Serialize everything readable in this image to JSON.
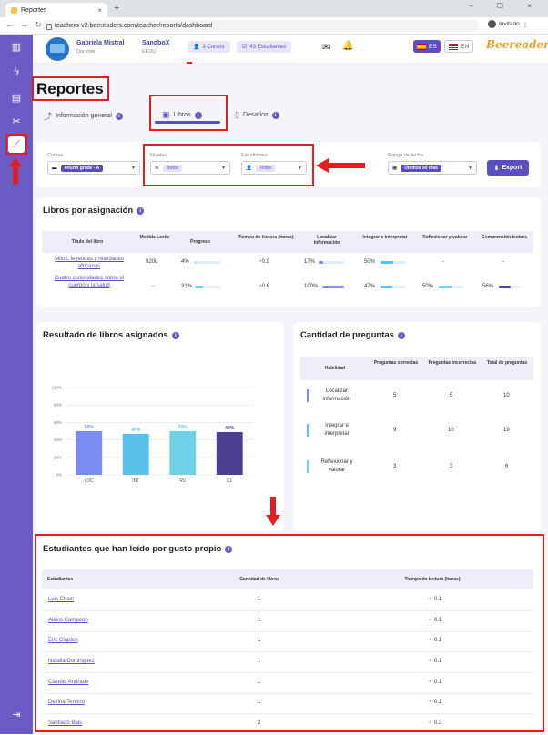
{
  "browser": {
    "tab_title": "Reportes",
    "url": "teachers-v2.beereaders.com/teacher/reports/dashboard",
    "profile": "Invitado"
  },
  "header": {
    "user_name": "Gabriela Mistral",
    "user_role": "Docente",
    "school_name": "SandboX",
    "school_sub": "EEUU",
    "courses_pill": "3 Cursos",
    "students_pill": "43 Estudiantes",
    "lang_es": "ES",
    "lang_en": "EN",
    "logo_text": "Beereaders"
  },
  "page": {
    "title": "Reportes",
    "tabs": [
      {
        "label": "Información general",
        "icon": "trend-icon"
      },
      {
        "label": "Libros",
        "icon": "book-icon",
        "active": true
      },
      {
        "label": "Desafíos",
        "icon": "document-icon"
      }
    ]
  },
  "filters": {
    "courses_label": "Cursos",
    "courses_value": "Fourth grade - A",
    "levels_label": "Niveles",
    "levels_value": "Todos",
    "students_label": "Estudiantes",
    "students_value": "Todos",
    "date_label": "Rango de fecha",
    "date_value": "Últimos 90 días",
    "export_label": "Export"
  },
  "assignment": {
    "title": "Libros por asignación",
    "headers": [
      "Título del libro",
      "Medida Lexile",
      "Progreso",
      "Tiempo de lectura (horas)",
      "Localizar información",
      "Integrar e interpretar",
      "Reflexionar y valorar",
      "Comprensión lectora"
    ],
    "rows": [
      {
        "title": "Mitos, leyendas y realidades africanas",
        "lexile": "920L",
        "progress": "4%",
        "progress_v": 4,
        "time": "0.9",
        "loc": "17%",
        "loc_v": 17,
        "int": "50%",
        "int_v": 50,
        "ref": "-",
        "ref_v": 0,
        "comp": "-",
        "comp_v": 0
      },
      {
        "title": "Cuatro curiosidades sobre el cuerpo y la salud",
        "lexile": "-",
        "progress": "31%",
        "progress_v": 31,
        "time": "0.6",
        "loc": "100%",
        "loc_v": 100,
        "int": "47%",
        "int_v": 47,
        "ref": "50%",
        "ref_v": 50,
        "comp": "56%",
        "comp_v": 56
      }
    ]
  },
  "results": {
    "title": "Resultado de libros asignados"
  },
  "chart_data": {
    "type": "bar",
    "categories": [
      "LOC",
      "INT",
      "RV",
      "CL"
    ],
    "values": [
      50,
      47,
      50,
      49
    ],
    "value_labels": [
      "50%",
      "47%",
      "50%",
      "49%"
    ],
    "colors": [
      "#7b8cf0",
      "#5bc0ea",
      "#6fd0e6",
      "#4b3f8f"
    ],
    "ylim": [
      0,
      100
    ],
    "yticks": [
      "0%",
      "20%",
      "40%",
      "60%",
      "80%",
      "100%"
    ],
    "title": "",
    "xlabel": "",
    "ylabel": ""
  },
  "questions": {
    "title": "Cantidad de preguntas",
    "headers": [
      "Habilidad",
      "Preguntas correctas",
      "Preguntas incorrectas",
      "Total de preguntas"
    ],
    "rows": [
      {
        "skill": "Localizar información",
        "correct": "5",
        "incorrect": "5",
        "total": "10",
        "color": "#7b8cf0"
      },
      {
        "skill": "Integrar e interpretar",
        "correct": "9",
        "incorrect": "10",
        "total": "19",
        "color": "#5bc0ea"
      },
      {
        "skill": "Reflexionar y valorar",
        "correct": "3",
        "incorrect": "3",
        "total": "6",
        "color": "#6fd0e6"
      }
    ]
  },
  "students": {
    "title": "Estudiantes que han leído por gusto propio",
    "headers": [
      "Estudiantes",
      "Cantidad de libros",
      "Tiempo de lectura (horas)"
    ],
    "rows": [
      {
        "name": "Luis Chain",
        "books": "1",
        "time": "0.1"
      },
      {
        "name": "Alexis Campeon",
        "books": "1",
        "time": "0.1"
      },
      {
        "name": "Eric Clapton",
        "books": "1",
        "time": "0.1"
      },
      {
        "name": "Natalia Dominguez",
        "books": "1",
        "time": "0.1"
      },
      {
        "name": "Claudio Andrade",
        "books": "1",
        "time": "0.1"
      },
      {
        "name": "Delfina Tenorio",
        "books": "1",
        "time": "0.1"
      },
      {
        "name": "Santiago Blas",
        "books": "2",
        "time": "0.3"
      }
    ]
  }
}
